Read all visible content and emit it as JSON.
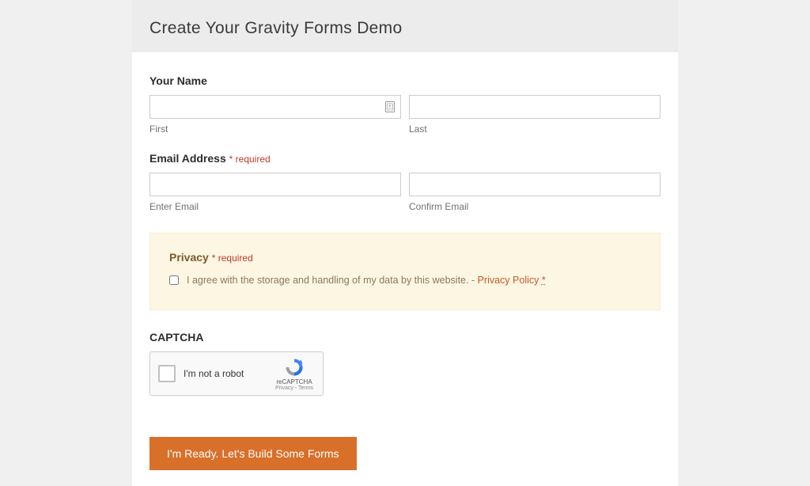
{
  "header": {
    "title": "Create Your Gravity Forms Demo"
  },
  "name": {
    "label": "Your Name",
    "first_sublabel": "First",
    "last_sublabel": "Last"
  },
  "email": {
    "label": "Email Address",
    "required": "* required",
    "enter_sublabel": "Enter Email",
    "confirm_sublabel": "Confirm Email"
  },
  "privacy": {
    "title": "Privacy",
    "required": "* required",
    "consent_text": "I agree with the storage and handling of my data by this website. - ",
    "policy_link": "Privacy Policy",
    "asterisk": "*"
  },
  "captcha": {
    "label": "CAPTCHA",
    "recaptcha_text": "I'm not a robot",
    "brand": "reCAPTCHA",
    "terms": "Privacy - Terms"
  },
  "submit": {
    "label": "I'm Ready. Let's Build Some Forms"
  }
}
